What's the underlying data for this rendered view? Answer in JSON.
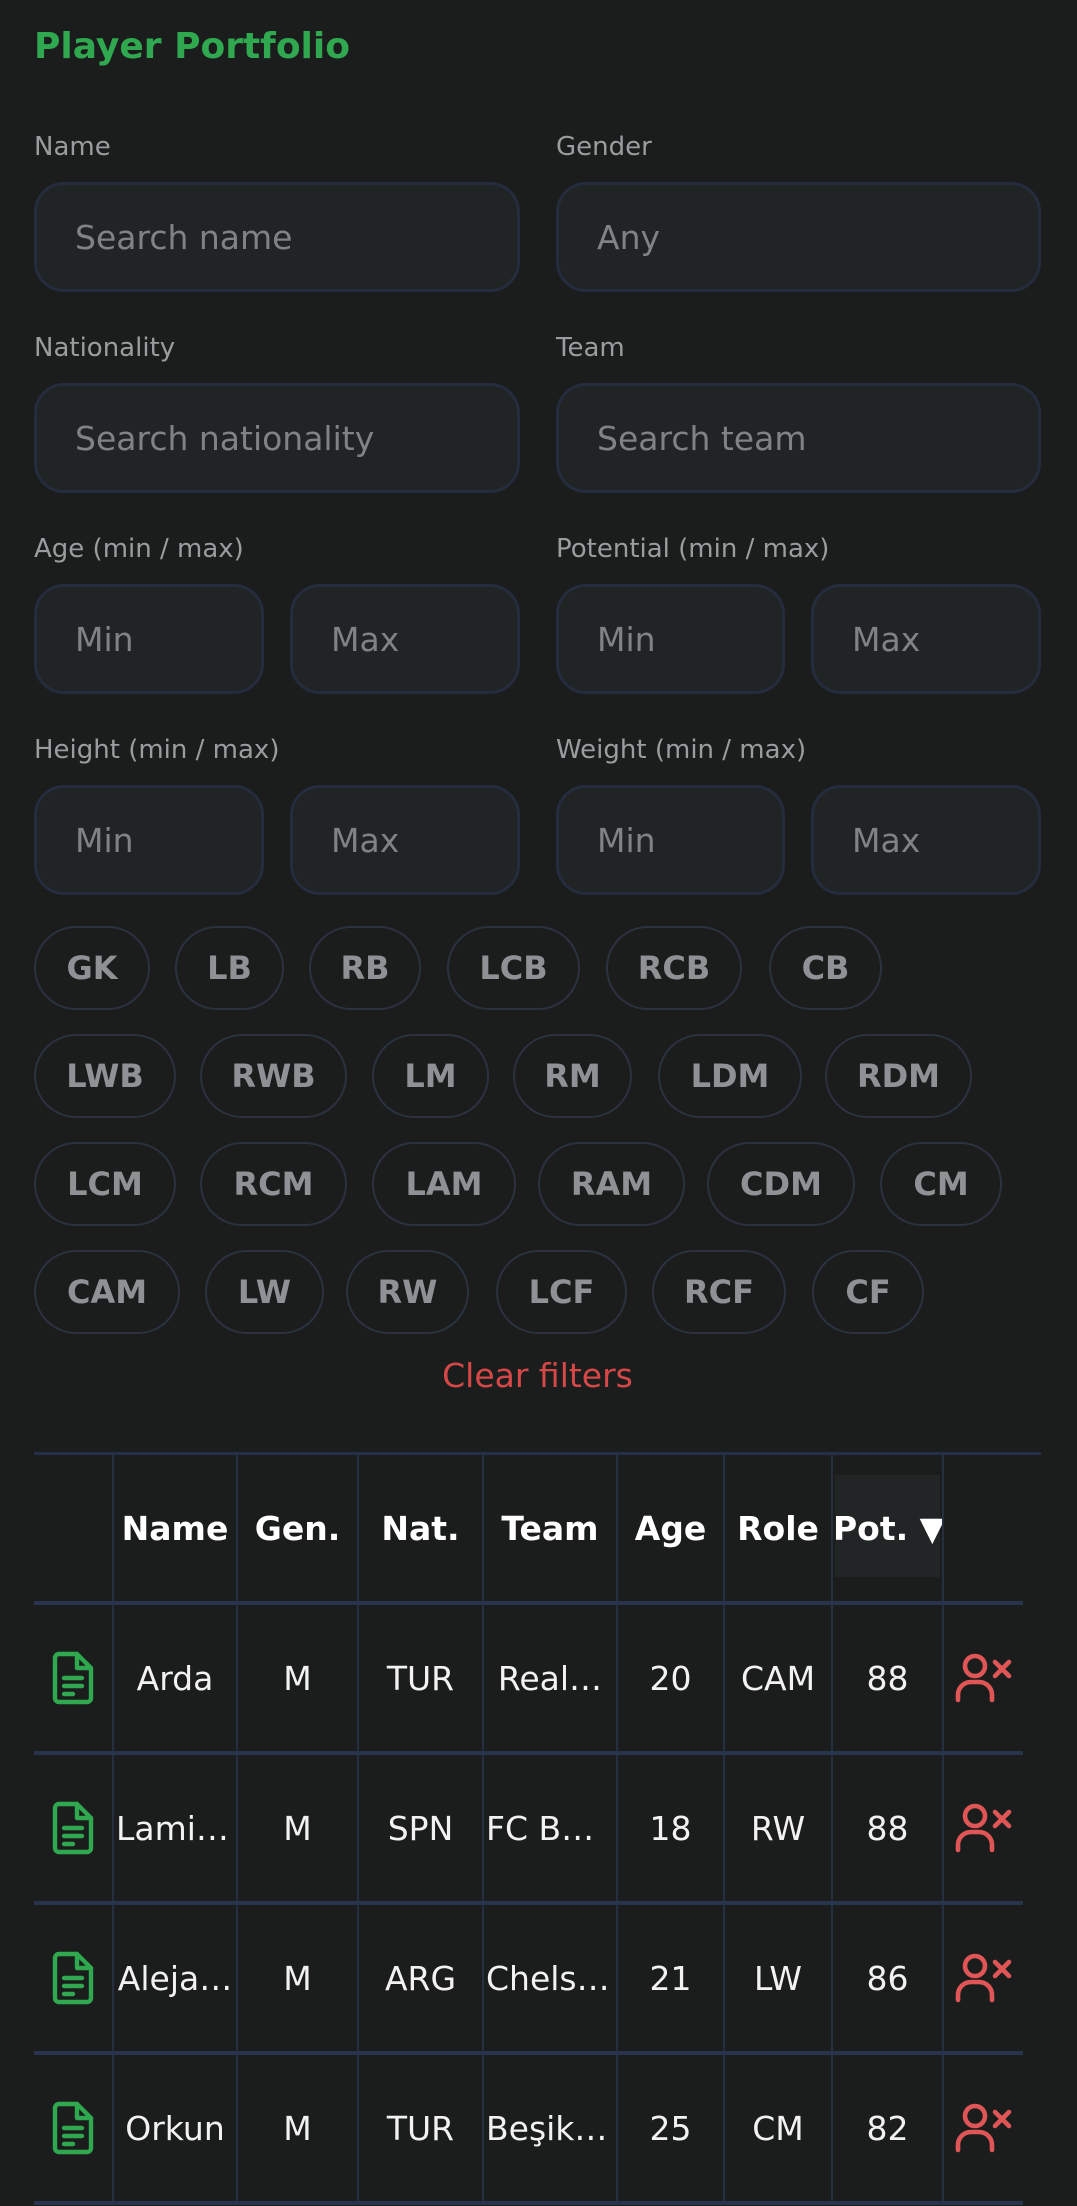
{
  "title": "Player Portfolio",
  "colors": {
    "accent": "#2fa84f",
    "danger": "#d64848",
    "background": "#1b1d1d",
    "input_bg": "#212424",
    "border": "#242c3e"
  },
  "filters": {
    "name": {
      "label": "Name",
      "placeholder": "Search name"
    },
    "gender": {
      "label": "Gender",
      "value": "Any"
    },
    "nationality": {
      "label": "Nationality",
      "placeholder": "Search nationality"
    },
    "team": {
      "label": "Team",
      "placeholder": "Search team"
    },
    "age": {
      "label": "Age (min / max)",
      "min_placeholder": "Min",
      "max_placeholder": "Max"
    },
    "potential": {
      "label": "Potential (min / max)",
      "min_placeholder": "Min",
      "max_placeholder": "Max"
    },
    "height": {
      "label": "Height (min / max)",
      "min_placeholder": "Min",
      "max_placeholder": "Max"
    },
    "weight": {
      "label": "Weight (min / max)",
      "min_placeholder": "Min",
      "max_placeholder": "Max"
    }
  },
  "positions": [
    "GK",
    "LB",
    "RB",
    "LCB",
    "RCB",
    "CB",
    "LWB",
    "RWB",
    "LM",
    "RM",
    "LDM",
    "RDM",
    "LCM",
    "RCM",
    "LAM",
    "RAM",
    "CDM",
    "CM",
    "CAM",
    "LW",
    "RW",
    "LCF",
    "RCF",
    "CF"
  ],
  "clear_filters": "Clear filters",
  "table": {
    "headers": {
      "name": "Name",
      "gender": "Gen.",
      "nationality": "Nat.",
      "team": "Team",
      "age": "Age",
      "role": "Role",
      "potential": "Pot. ▼"
    },
    "rows": [
      {
        "name": "Arda",
        "gender": "M",
        "nationality": "TUR",
        "team": "Real…",
        "age": "20",
        "role": "CAM",
        "potential": "88"
      },
      {
        "name": "Lamine",
        "gender": "M",
        "nationality": "SPN",
        "team": "FC Ba…",
        "age": "18",
        "role": "RW",
        "potential": "88"
      },
      {
        "name": "Aleja…",
        "gender": "M",
        "nationality": "ARG",
        "team": "Chelsea",
        "age": "21",
        "role": "LW",
        "potential": "86"
      },
      {
        "name": "Orkun",
        "gender": "M",
        "nationality": "TUR",
        "team": "Beşikt…",
        "age": "25",
        "role": "CM",
        "potential": "82"
      }
    ],
    "row_icons": {
      "open": "document-icon",
      "remove": "remove-user-icon"
    }
  }
}
